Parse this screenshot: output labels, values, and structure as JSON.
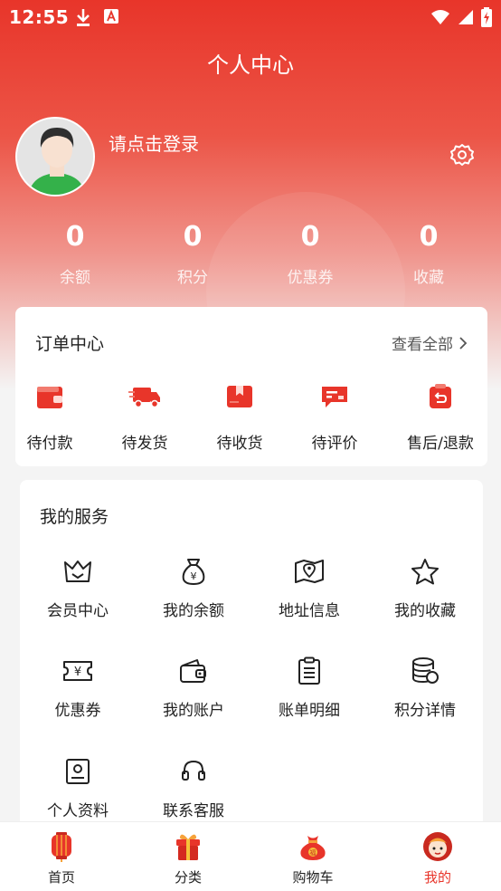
{
  "status_bar": {
    "time": "12:55",
    "icons": [
      "download-icon",
      "a-icon",
      "wifi-icon",
      "signal-icon",
      "battery-icon"
    ]
  },
  "header": {
    "title": "个人中心"
  },
  "profile": {
    "login_prompt": "请点击登录"
  },
  "stats": [
    {
      "value": "0",
      "label": "余额"
    },
    {
      "value": "0",
      "label": "积分"
    },
    {
      "value": "0",
      "label": "优惠券"
    },
    {
      "value": "0",
      "label": "收藏"
    }
  ],
  "orders": {
    "title": "订单中心",
    "view_all": "查看全部",
    "items": [
      {
        "label": "待付款",
        "icon": "wallet-icon"
      },
      {
        "label": "待发货",
        "icon": "truck-icon"
      },
      {
        "label": "待收货",
        "icon": "box-icon"
      },
      {
        "label": "待评价",
        "icon": "comment-icon"
      },
      {
        "label": "售后/退款",
        "icon": "refund-icon"
      }
    ]
  },
  "services": {
    "title": "我的服务",
    "items": [
      {
        "label": "会员中心",
        "icon": "crown-icon"
      },
      {
        "label": "我的余额",
        "icon": "money-bag-icon"
      },
      {
        "label": "地址信息",
        "icon": "map-icon"
      },
      {
        "label": "我的收藏",
        "icon": "star-icon"
      },
      {
        "label": "优惠券",
        "icon": "ticket-icon"
      },
      {
        "label": "我的账户",
        "icon": "wallet-outline-icon"
      },
      {
        "label": "账单明细",
        "icon": "clipboard-icon"
      },
      {
        "label": "积分详情",
        "icon": "coins-icon"
      },
      {
        "label": "个人资料",
        "icon": "profile-icon"
      },
      {
        "label": "联系客服",
        "icon": "headset-icon"
      }
    ]
  },
  "tabbar": {
    "items": [
      {
        "label": "首页",
        "icon": "lantern-icon"
      },
      {
        "label": "分类",
        "icon": "gift-box-icon"
      },
      {
        "label": "购物车",
        "icon": "lucky-bag-icon"
      },
      {
        "label": "我的",
        "icon": "mascot-icon"
      }
    ],
    "active_index": 3
  },
  "colors": {
    "brand": "#e8352a",
    "card": "#ffffff",
    "bg": "#f4f4f4"
  }
}
